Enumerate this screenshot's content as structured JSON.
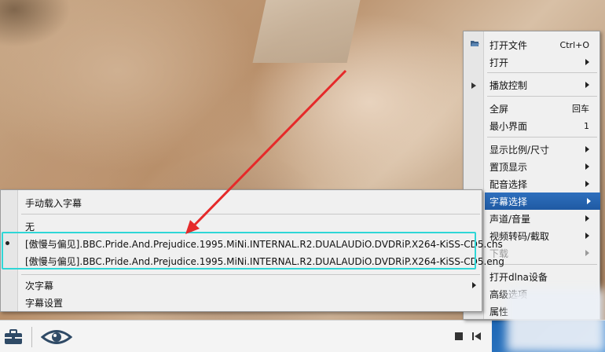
{
  "context_menu": {
    "items": [
      {
        "label": "打开文件",
        "shortcut": "Ctrl+O"
      },
      {
        "label": "打开"
      },
      {
        "label": "播放控制"
      },
      {
        "label": "全屏",
        "shortcut": "回车"
      },
      {
        "label": "最小界面",
        "shortcut": "1"
      },
      {
        "label": "显示比例/尺寸"
      },
      {
        "label": "置顶显示"
      },
      {
        "label": "配音选择"
      },
      {
        "label": "字幕选择"
      },
      {
        "label": "声道/音量"
      },
      {
        "label": "视频转码/截取"
      },
      {
        "label": "下载"
      },
      {
        "label": "打开dlna设备"
      },
      {
        "label": "高级选项"
      },
      {
        "label": "属性"
      }
    ]
  },
  "subtitle_menu": {
    "items": [
      {
        "label": "手动载入字幕"
      },
      {
        "label": "无"
      },
      {
        "label": "[傲慢与偏见].BBC.Pride.And.Prejudice.1995.MiNi.INTERNAL.R2.DUALAUDiO.DVDRiP.X264-KiSS-CD5.chs"
      },
      {
        "label": "[傲慢与偏见].BBC.Pride.And.Prejudice.1995.MiNi.INTERNAL.R2.DUALAUDiO.DVDRiP.X264-KiSS-CD5.eng"
      },
      {
        "label": "次字幕"
      },
      {
        "label": "字幕设置"
      }
    ],
    "selected_index": 2
  },
  "colors": {
    "menu_highlight": "#2a66b3",
    "annotation_box": "#2fd6d6",
    "annotation_arrow": "#e52a2a",
    "control_bar": "#f4f4f4"
  },
  "icons": [
    "toolbox-icon",
    "eye-icon",
    "stop-icon",
    "previous-icon",
    "open-file-icon",
    "play-control-arrow-icon"
  ]
}
